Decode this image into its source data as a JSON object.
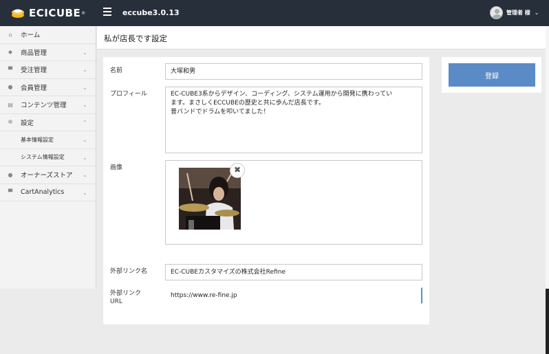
{
  "header": {
    "logo_text": "ECICUBE",
    "logo_reg": "®",
    "version": "eccube3.0.13",
    "user_name": "管理者 様",
    "user_chevron": "⌄"
  },
  "sidebar": {
    "items": [
      {
        "label": "ホーム",
        "icon": "home-icon",
        "glyph": "⌂",
        "chevron": ""
      },
      {
        "label": "商品管理",
        "icon": "tag-icon",
        "glyph": "◆",
        "chevron": "⌄"
      },
      {
        "label": "受注管理",
        "icon": "cart-icon",
        "glyph": "▀",
        "chevron": "⌄"
      },
      {
        "label": "会員管理",
        "icon": "users-icon",
        "glyph": "●",
        "chevron": "⌄"
      },
      {
        "label": "コンテンツ管理",
        "icon": "document-icon",
        "glyph": "▤",
        "chevron": "⌄"
      },
      {
        "label": "設定",
        "icon": "gear-icon",
        "glyph": "✻",
        "chevron": "⌃"
      },
      {
        "label": "基本情報設定",
        "icon": "",
        "glyph": "",
        "chevron": "⌄"
      },
      {
        "label": "システム情報設定",
        "icon": "",
        "glyph": "",
        "chevron": "⌄"
      },
      {
        "label": "オーナーズストア",
        "icon": "info-icon",
        "glyph": "●",
        "chevron": "⌄"
      },
      {
        "label": "CartAnalytics",
        "icon": "cart-icon",
        "glyph": "▀",
        "chevron": "⌄"
      }
    ]
  },
  "page": {
    "title": "私が店長です設定"
  },
  "form": {
    "name_label": "名前",
    "name_value": "大塚和男",
    "profile_label": "プロフィール",
    "profile_lines": [
      "EC-CUBE3系からデザイン、コーディング、システム運用から開発に携わってい",
      "ます。まさしくECCUBEの歴史と共に歩んだ店長です。",
      "昔バンドでドラムを叩いてました！"
    ],
    "image_label": "画像",
    "remove_glyph": "✖",
    "link_name_label": "外部リンク名",
    "link_name_value": "EC-CUBEカスタマイズの株式会社Refine",
    "link_url_label_1": "外部リンク",
    "link_url_label_2": "URL",
    "link_url_value": "https://www.re-fine.jp"
  },
  "actions": {
    "save_label": "登録"
  },
  "colors": {
    "topbar": "#262f3a",
    "accent": "#5b8bc6",
    "logo_mark": "#f5b21a"
  }
}
